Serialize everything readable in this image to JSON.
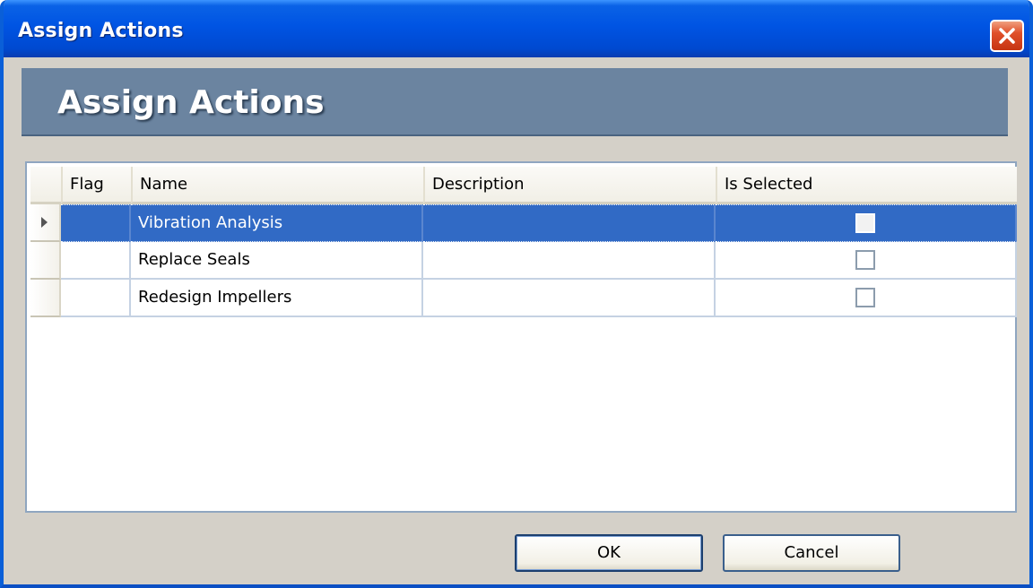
{
  "window": {
    "title": "Assign Actions"
  },
  "header": {
    "title": "Assign Actions"
  },
  "grid": {
    "columns": [
      "Flag",
      "Name",
      "Description",
      "Is Selected"
    ],
    "rows": [
      {
        "flag": "",
        "name": "Vibration Analysis",
        "description": "",
        "is_selected": false,
        "selected_row": true
      },
      {
        "flag": "",
        "name": "Replace Seals",
        "description": "",
        "is_selected": false,
        "selected_row": false
      },
      {
        "flag": "",
        "name": "Redesign Impellers",
        "description": "",
        "is_selected": false,
        "selected_row": false
      }
    ]
  },
  "buttons": {
    "ok_label": "OK",
    "cancel_label": "Cancel"
  },
  "icons": {
    "close": "close-icon",
    "row_pointer": "row-pointer-icon"
  },
  "colors": {
    "titlebar": "#0054e3",
    "header_band": "#6b84a0",
    "selection": "#316ac5",
    "close_button": "#e0502a"
  }
}
